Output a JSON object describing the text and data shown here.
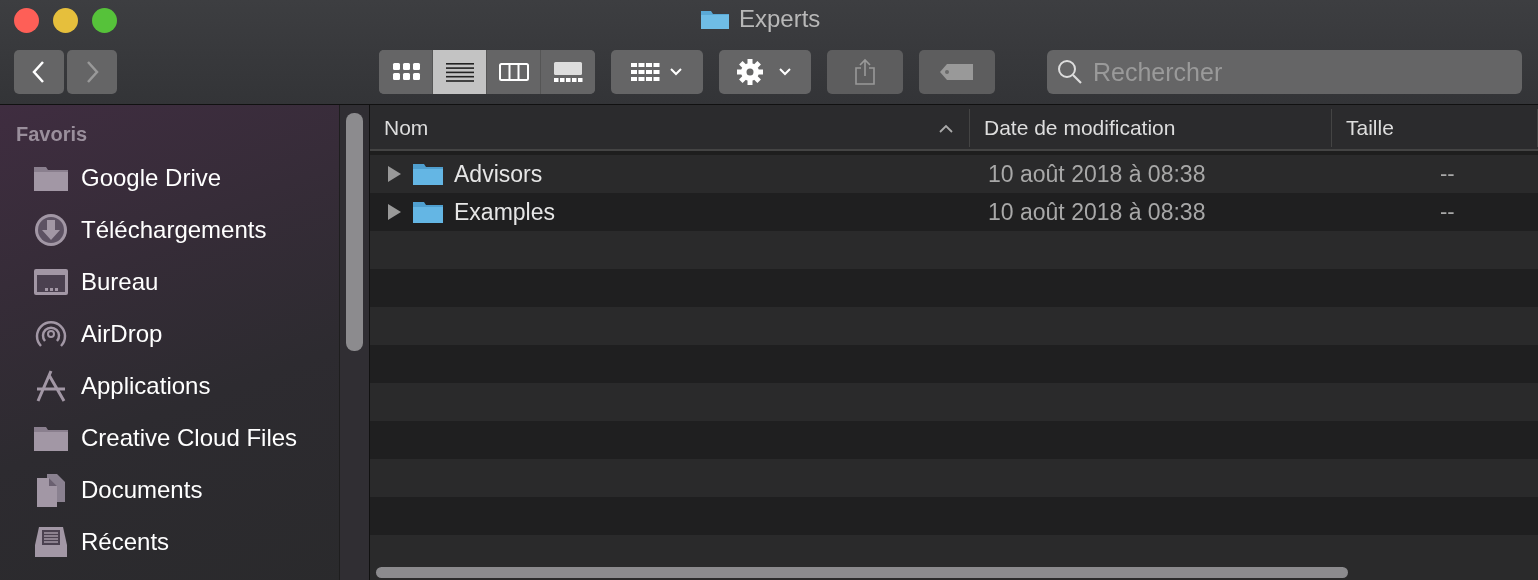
{
  "window": {
    "title": "Experts"
  },
  "toolbar": {
    "view_buttons": [
      {
        "kind": "icons",
        "selected": false
      },
      {
        "kind": "list",
        "selected": true
      },
      {
        "kind": "columns",
        "selected": false
      },
      {
        "kind": "gallery",
        "selected": false
      }
    ],
    "search": {
      "placeholder": "Rechercher"
    }
  },
  "sidebar": {
    "heading": "Favoris",
    "items": [
      {
        "kind": "folder",
        "label": "Google Drive"
      },
      {
        "kind": "download",
        "label": "Téléchargements"
      },
      {
        "kind": "desktop",
        "label": "Bureau"
      },
      {
        "kind": "airdrop",
        "label": "AirDrop"
      },
      {
        "kind": "apps",
        "label": "Applications"
      },
      {
        "kind": "folder",
        "label": "Creative Cloud Files"
      },
      {
        "kind": "documents",
        "label": "Documents"
      },
      {
        "kind": "recents",
        "label": "Récents"
      }
    ]
  },
  "table": {
    "columns": [
      {
        "label": "Nom",
        "sorted": true
      },
      {
        "label": "Date de modification",
        "sorted": false
      },
      {
        "label": "Taille",
        "sorted": false
      }
    ],
    "rows": [
      {
        "name": "Advisors",
        "date": "10 août 2018 à 08:38",
        "size": "--",
        "expanded": false
      },
      {
        "name": "Examples",
        "date": "10 août 2018 à 08:38",
        "size": "--",
        "expanded": false
      }
    ]
  }
}
